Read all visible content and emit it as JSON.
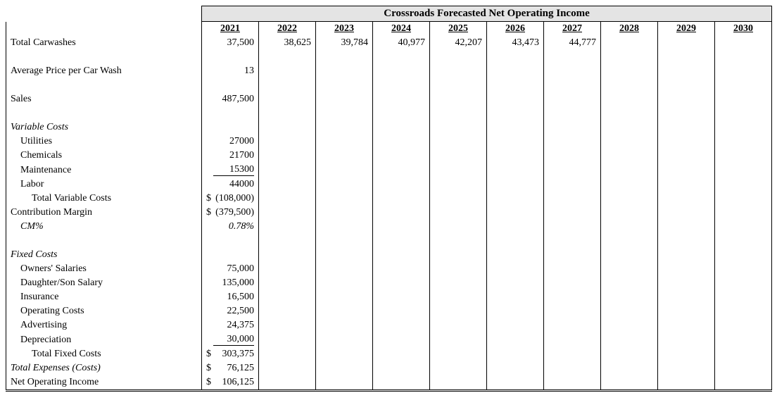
{
  "chart_data": {
    "type": "table",
    "title": "Crossroads Forecasted Net Operating Income",
    "years": [
      "2021",
      "2022",
      "2023",
      "2024",
      "2025",
      "2026",
      "2027",
      "2028",
      "2029",
      "2030"
    ],
    "rows": [
      {
        "label": "Total Carwashes",
        "values": [
          "37,500",
          "38,625",
          "39,784",
          "40,977",
          "42,207",
          "43,473",
          "44,777",
          "",
          "",
          ""
        ]
      },
      {
        "label": "Average Price per Car Wash",
        "values": [
          "13",
          "",
          "",
          "",
          "",
          "",
          "",
          "",
          "",
          ""
        ]
      },
      {
        "label": "Sales",
        "values": [
          "487,500",
          "",
          "",
          "",
          "",
          "",
          "",
          "",
          "",
          ""
        ]
      },
      {
        "label": "Utilities",
        "values": [
          "27000"
        ]
      },
      {
        "label": "Chemicals",
        "values": [
          "21700"
        ]
      },
      {
        "label": "Maintenance",
        "values": [
          "15300"
        ]
      },
      {
        "label": "Labor",
        "values": [
          "44000"
        ]
      },
      {
        "label": "Total Variable Costs",
        "values": [
          "(108,000)"
        ],
        "currency": true
      },
      {
        "label": "Contribution Margin",
        "values": [
          "(379,500)"
        ],
        "currency": true
      },
      {
        "label": "CM%",
        "values": [
          "0.78%"
        ]
      },
      {
        "label": "Owners' Salaries",
        "values": [
          "75,000"
        ]
      },
      {
        "label": "Daughter/Son Salary",
        "values": [
          "135,000"
        ]
      },
      {
        "label": "Insurance",
        "values": [
          "16,500"
        ]
      },
      {
        "label": "Operating Costs",
        "values": [
          "22,500"
        ]
      },
      {
        "label": "Advertising",
        "values": [
          "24,375"
        ]
      },
      {
        "label": "Depreciation",
        "values": [
          "30,000"
        ]
      },
      {
        "label": "Total Fixed Costs",
        "values": [
          "303,375"
        ],
        "currency": true
      },
      {
        "label": "Total Expenses (Costs)",
        "values": [
          "76,125"
        ],
        "currency": true
      },
      {
        "label": "Net Operating Income",
        "values": [
          "106,125"
        ],
        "currency": true
      }
    ]
  },
  "title": "Crossroads Forecasted Net Operating Income",
  "years": {
    "y0": "2021",
    "y1": "2022",
    "y2": "2023",
    "y3": "2024",
    "y4": "2025",
    "y5": "2026",
    "y6": "2027",
    "y7": "2028",
    "y8": "2029",
    "y9": "2030"
  },
  "rows": {
    "total_carwashes": {
      "label": "Total Carwashes",
      "v0": "37,500",
      "v1": "38,625",
      "v2": "39,784",
      "v3": "40,977",
      "v4": "42,207",
      "v5": "43,473",
      "v6": "44,777"
    },
    "avg_price": {
      "label": "Average Price per Car Wash",
      "v0": "13"
    },
    "sales": {
      "label": "Sales",
      "v0": "487,500"
    },
    "variable_heading": {
      "label": "Variable Costs"
    },
    "utilities": {
      "label": "Utilities",
      "v0": "27000"
    },
    "chemicals": {
      "label": "Chemicals",
      "v0": "21700"
    },
    "maintenance": {
      "label": "Maintenance",
      "v0": "15300"
    },
    "labor": {
      "label": "Labor",
      "v0": "44000"
    },
    "total_variable": {
      "label": "Total Variable Costs",
      "sym": "$",
      "v0": "(108,000)"
    },
    "contribution": {
      "label": "Contribution Margin",
      "sym": "$",
      "v0": "(379,500)"
    },
    "cm_pct": {
      "label": "CM%",
      "v0": "0.78%"
    },
    "fixed_heading": {
      "label": "Fixed Costs"
    },
    "owners": {
      "label": "Owners' Salaries",
      "v0": "75,000"
    },
    "daughter": {
      "label": "Daughter/Son Salary",
      "v0": "135,000"
    },
    "insurance": {
      "label": "Insurance",
      "v0": "16,500"
    },
    "operating": {
      "label": "Operating Costs",
      "v0": "22,500"
    },
    "advertising": {
      "label": "Advertising",
      "v0": "24,375"
    },
    "depreciation": {
      "label": "Depreciation",
      "v0": "30,000"
    },
    "total_fixed": {
      "label": "Total Fixed Costs",
      "sym": "$",
      "v0": "303,375"
    },
    "total_expenses": {
      "label": "Total Expenses (Costs)",
      "sym": "$",
      "v0": "76,125"
    },
    "net_income": {
      "label": "Net Operating Income",
      "sym": "$",
      "v0": "106,125"
    }
  }
}
